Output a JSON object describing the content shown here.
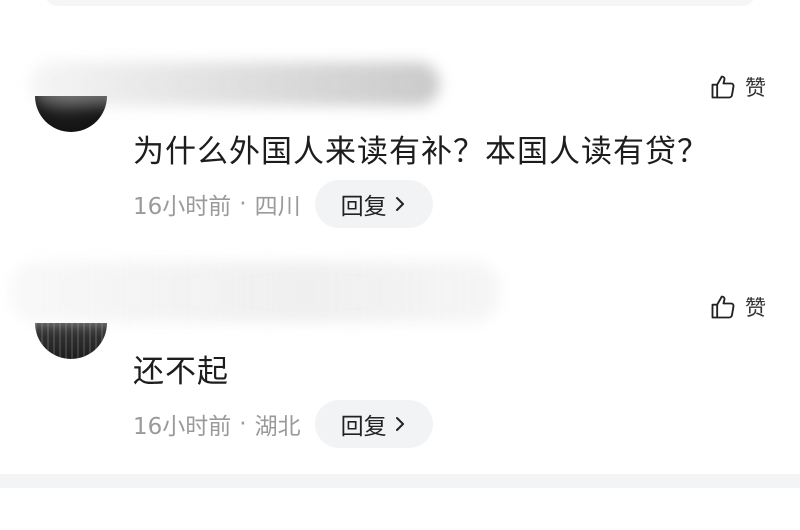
{
  "comments": [
    {
      "text": "为什么外国人来读有补？本国人读有贷？",
      "time": "16小时前",
      "separator": "·",
      "location": "四川",
      "reply_label": "回复",
      "like_label": "赞"
    },
    {
      "text": "还不起",
      "time": "16小时前",
      "separator": "·",
      "location": "湖北",
      "reply_label": "回复",
      "like_label": "赞"
    }
  ],
  "icons": {
    "like": "thumbs-up-icon",
    "reply_arrow": "chevron-right-icon"
  },
  "colors": {
    "text_primary": "#1d1d1d",
    "text_meta": "#9a9a9a",
    "reply_bg": "#f2f3f5"
  }
}
